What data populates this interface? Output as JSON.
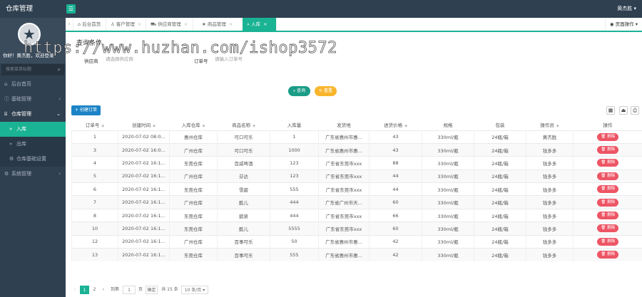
{
  "app": {
    "title": "仓库管理",
    "user": "黄杰胜"
  },
  "sidebar": {
    "welcome": "你好！黄杰胜，欢迎登录",
    "search_placeholder": "搜索菜单标题",
    "items": [
      {
        "label": "后台首页",
        "icon": "home-icon"
      },
      {
        "label": "基础管理",
        "icon": "info-icon",
        "arrow": "‹"
      },
      {
        "label": "仓库管理",
        "icon": "bag-icon",
        "arrow": "⌄"
      },
      {
        "label": "入库",
        "icon": "double-chevron-icon",
        "active": true
      },
      {
        "label": "出库",
        "icon": "double-chevron-icon"
      },
      {
        "label": "仓库基础设置",
        "icon": "gear-icon"
      },
      {
        "label": "系统管理",
        "icon": "gear-icon",
        "arrow": "‹"
      }
    ]
  },
  "tabs": [
    {
      "label": "后台首页"
    },
    {
      "label": "客户管理"
    },
    {
      "label": "供应商管理"
    },
    {
      "label": "商品管理"
    },
    {
      "label": "入库"
    }
  ],
  "page_ops_label": "页面操作",
  "query": {
    "title": "查询条件",
    "supplier_label": "供应商",
    "supplier_placeholder": "请选择供应商",
    "order_label": "订单号",
    "order_placeholder": "请输入订单号",
    "search_label": "查询",
    "reset_label": "重置"
  },
  "create_label": "创建订单",
  "table": {
    "columns": [
      "订单号",
      "创建时间",
      "入库仓库",
      "商品名称",
      "入库量",
      "发货地",
      "进货价格",
      "规格",
      "包装",
      "操作员",
      "操作"
    ],
    "delete_label": "删除",
    "rows": [
      [
        "1",
        "2020-07-02 08:0...",
        "惠州仓库",
        "可口可乐",
        "1",
        "广东省惠州市惠...",
        "43",
        "330ml/瓶",
        "24瓶/箱",
        "黄杰胜"
      ],
      [
        "3",
        "2020-07-02 16:0...",
        "广州仓库",
        "可口可乐",
        "1000",
        "广东省惠州市惠...",
        "43",
        "330ml/瓶",
        "24瓶/箱",
        "钱多多"
      ],
      [
        "4",
        "2020-07-02 16:1...",
        "东莞仓库",
        "百威啤酒",
        "123",
        "广东省东莞市xxx",
        "88",
        "330ml/瓶",
        "24瓶/箱",
        "钱多多"
      ],
      [
        "5",
        "2020-07-02 16:1...",
        "广州仓库",
        "芬达",
        "123",
        "广东省东莞市xxx",
        "44",
        "330ml/瓶",
        "24瓶/箱",
        "钱多多"
      ],
      [
        "6",
        "2020-07-02 16:1...",
        "东莞仓库",
        "雪碧",
        "555",
        "广东省东莞市xxx",
        "44",
        "330ml/瓶",
        "24瓶/箱",
        "钱多多"
      ],
      [
        "7",
        "2020-07-02 16:1...",
        "广州仓库",
        "酷儿",
        "444",
        "广东省广州市天...",
        "60",
        "330ml/瓶",
        "24瓶/箱",
        "钱多多"
      ],
      [
        "8",
        "2020-07-02 16:1...",
        "东莞仓库",
        "碧泉",
        "444",
        "广东省东莞市xxx",
        "66",
        "330ml/瓶",
        "24瓶/箱",
        "钱多多"
      ],
      [
        "10",
        "2020-07-02 16:1...",
        "东莞仓库",
        "酷儿",
        "5555",
        "广东省东莞市xxx",
        "60",
        "330ml/瓶",
        "24瓶/箱",
        "钱多多"
      ],
      [
        "12",
        "2020-07-02 16:1...",
        "广州仓库",
        "百事可乐",
        "50",
        "广东省惠州市惠...",
        "42",
        "330ml/瓶",
        "24瓶/箱",
        "钱多多"
      ],
      [
        "13",
        "2020-07-02 16:1...",
        "东莞仓库",
        "百事可乐",
        "555",
        "广东省惠州市惠...",
        "42",
        "330ml/瓶",
        "24瓶/箱",
        "钱多多"
      ]
    ]
  },
  "pager": {
    "prev": "‹",
    "pages": [
      "1",
      "2"
    ],
    "next": "›",
    "goto_label": "到第",
    "goto_value": "1",
    "page_unit": "页",
    "confirm_label": "确定",
    "total_label": "共 15 条",
    "per_page": "10 条/页"
  },
  "watermark": "https://www.huzhan.com/ishop3572",
  "colors": {
    "sidebar": "#2f4050",
    "accent": "#1ab394",
    "danger": "#ed5565",
    "primary": "#1c84c6",
    "warning": "#f8b52c"
  }
}
